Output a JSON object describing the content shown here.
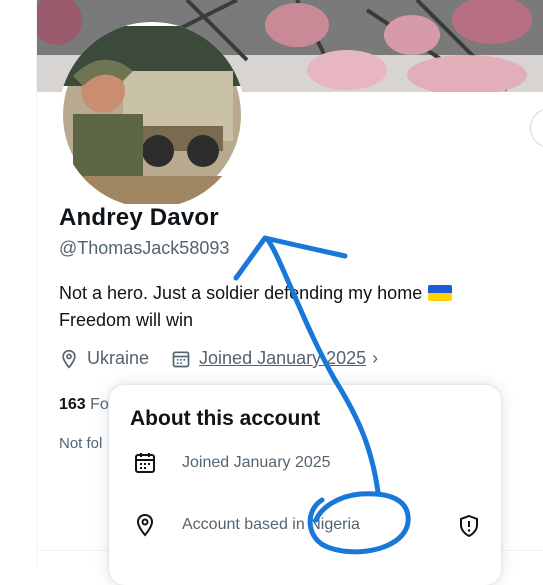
{
  "profile": {
    "name": "Andrey Davor",
    "handle": "@ThomasJack58093",
    "bio_line1": "Not a hero. Just a soldier defending my home",
    "bio_line2": "Freedom will win",
    "location": "Ukraine",
    "joined": "Joined January 2025",
    "following_count": "163",
    "following_label": "Fo",
    "not_followed": "Not fol"
  },
  "about_popup": {
    "title": "About this account",
    "joined": "Joined January 2025",
    "based_prefix": "Account based in ",
    "based_country": "Nigeria"
  },
  "colors": {
    "annotation": "#1877d8",
    "muted": "#536471",
    "text": "#0f1419",
    "flag_blue": "#1e5bd8",
    "flag_yellow": "#ffd200"
  },
  "icons": [
    "location-pin-icon",
    "calendar-icon",
    "chevron-right-icon",
    "shield-icon"
  ]
}
